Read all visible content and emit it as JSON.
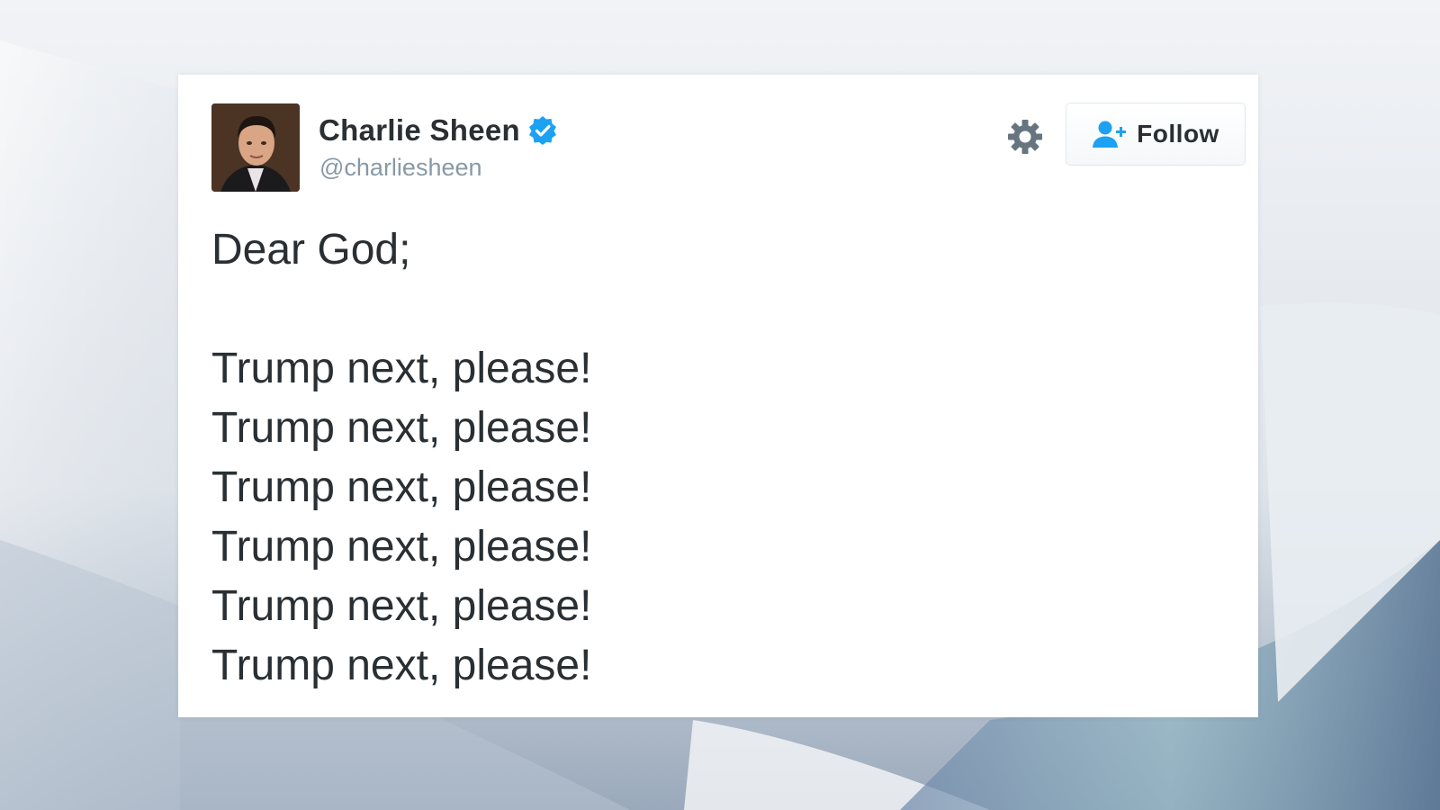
{
  "tweet": {
    "author": {
      "display_name": "Charlie Sheen",
      "handle": "@charliesheen",
      "verified": true
    },
    "follow_button_label": "Follow",
    "text_lines": [
      "Dear God;",
      "",
      "Trump next, please!",
      "Trump next, please!",
      "Trump next, please!",
      "Trump next, please!",
      "Trump next, please!",
      "Trump next, please!"
    ]
  },
  "icons": {
    "verified": "verified-badge-icon",
    "settings": "gear-icon",
    "follow": "add-user-icon"
  },
  "colors": {
    "verified_blue": "#1da1f2",
    "follow_icon_blue": "#1da1f2",
    "text": "#292f33",
    "handle_gray": "#8899a6",
    "gear_gray": "#66757f"
  }
}
